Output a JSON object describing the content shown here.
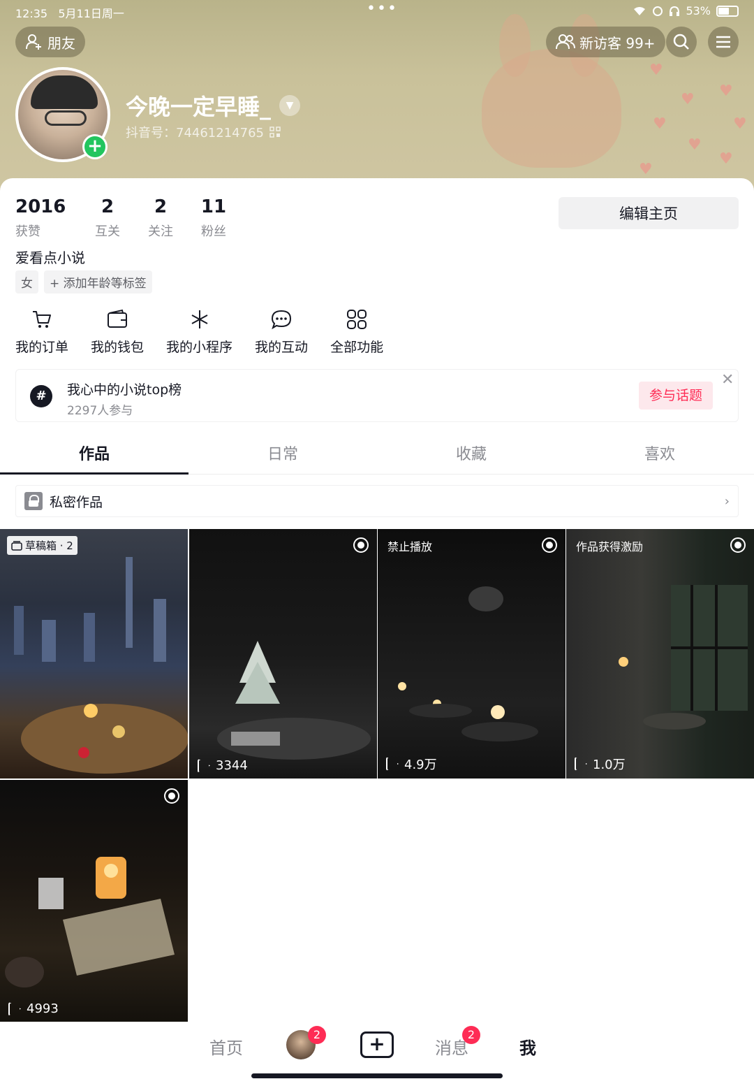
{
  "status_bar": {
    "time": "12:35",
    "date": "5月11日周一",
    "battery": "53%"
  },
  "header": {
    "friends_label": "朋友",
    "visitors_label": "新访客 99+",
    "nickname": "今晚一定早睡_",
    "douyin_id": "抖音号：74461214765"
  },
  "stats": [
    {
      "value": "2016",
      "label": "获赞"
    },
    {
      "value": "2",
      "label": "互关"
    },
    {
      "value": "2",
      "label": "关注"
    },
    {
      "value": "11",
      "label": "粉丝"
    }
  ],
  "edit_profile_label": "编辑主页",
  "bio": "爱看点小说",
  "tags": [
    "女",
    "+ 添加年龄等标签"
  ],
  "functions": [
    {
      "label": "我的订单",
      "icon": "cart-icon"
    },
    {
      "label": "我的钱包",
      "icon": "wallet-icon"
    },
    {
      "label": "我的小程序",
      "icon": "mini-program-icon"
    },
    {
      "label": "我的互动",
      "icon": "chat-bubble-icon"
    },
    {
      "label": "全部功能",
      "icon": "grid-icon"
    }
  ],
  "topic": {
    "title": "我心中的小说top榜",
    "participants": "2297人参与",
    "join_label": "参与话题"
  },
  "tabs": [
    "作品",
    "日常",
    "收藏",
    "喜欢"
  ],
  "private_works_label": "私密作品",
  "videos": [
    {
      "badge": "草稿箱 · 2",
      "plays": ""
    },
    {
      "badge": "",
      "plays": "3344"
    },
    {
      "badge": "禁止播放",
      "plays": "4.9万"
    },
    {
      "badge": "作品获得激励",
      "plays": "1.0万"
    },
    {
      "badge": "",
      "plays": "4993"
    }
  ],
  "bottom_nav": {
    "home": "首页",
    "friend_badge": "2",
    "messages": "消息",
    "messages_badge": "2",
    "me": "我"
  }
}
